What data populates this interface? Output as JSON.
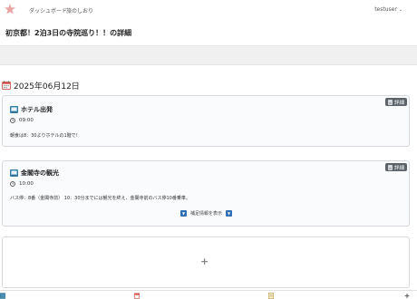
{
  "nav": {
    "dashboard": "ダッシュボード",
    "create": "旅のしおり",
    "user": "testuser"
  },
  "page": {
    "title": "初京都！2泊3日の寺院巡り！！の詳細"
  },
  "day": {
    "date": "2025年06月12日"
  },
  "spots": [
    {
      "title": "ホテル出発",
      "time": "09:00",
      "memo": "朝食は8：30よりホテルの1階で！",
      "detail_label": "詳細"
    },
    {
      "title": "金閣寺の観光",
      "time": "10:00",
      "memo": "バス停：8番（金閣寺前） 10：30分までには観光を終え、金閣寺前のバス停10番乗車。",
      "detail_label": "詳細",
      "toggle_label": "補足情報を表示"
    }
  ],
  "add": {
    "symbol": "+"
  },
  "colors": {
    "accent": "#2f6fb3",
    "detail_button": "#5c636a",
    "card_bg": "#fafbfc"
  }
}
